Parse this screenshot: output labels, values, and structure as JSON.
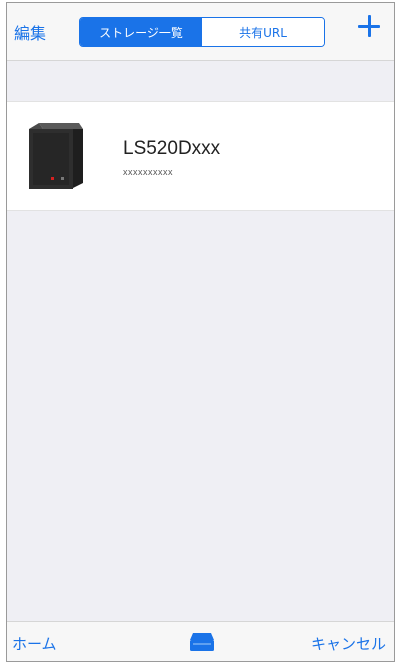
{
  "navbar": {
    "edit_label": "編集",
    "segments": [
      {
        "label": "ストレージ一覧",
        "active": true
      },
      {
        "label": "共有URL",
        "active": false
      }
    ],
    "add_icon": "plus-icon"
  },
  "devices": [
    {
      "name": "LS520Dxxx",
      "subtitle": "xxxxxxxxxx",
      "icon": "nas-device-icon"
    }
  ],
  "toolbar": {
    "home_label": "ホーム",
    "center_icon": "storage-icon",
    "cancel_label": "キャンセル"
  },
  "colors": {
    "accent": "#1a73e8",
    "background": "#efeff4",
    "bar": "#f7f7f7"
  }
}
